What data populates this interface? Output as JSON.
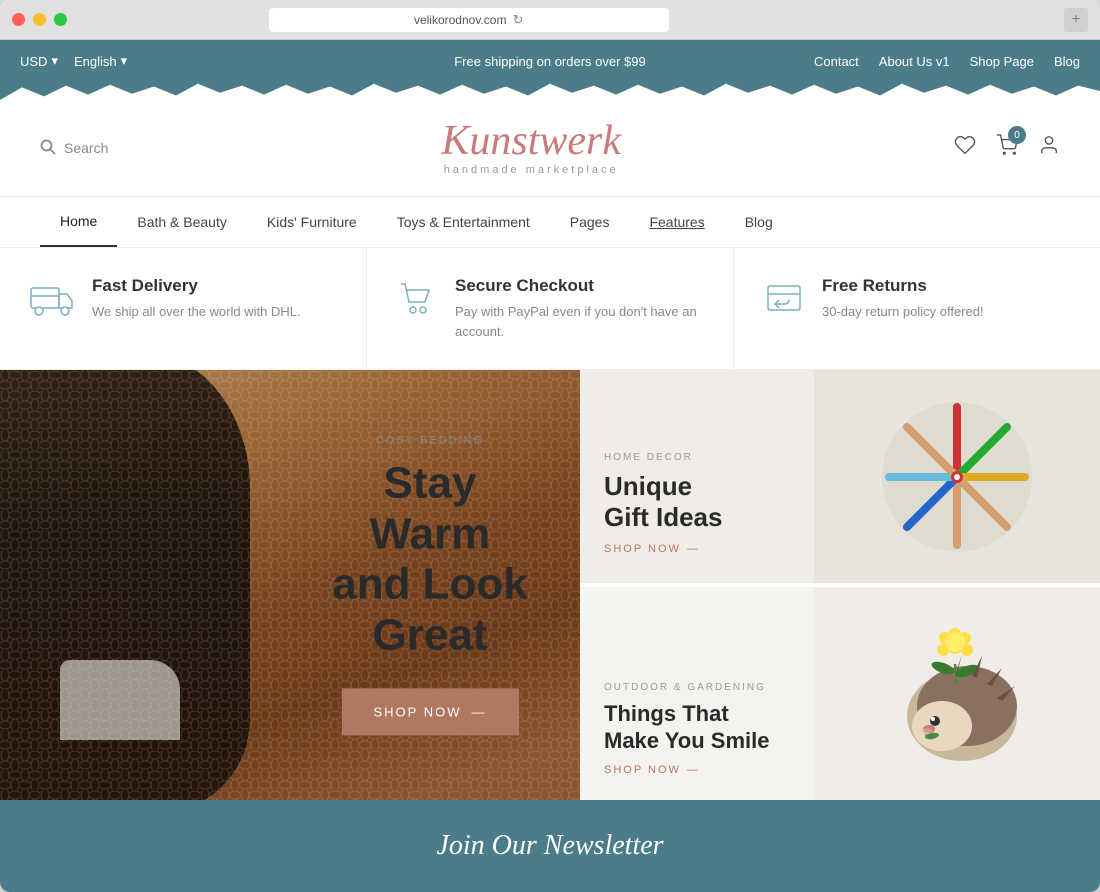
{
  "browser": {
    "url": "velikorodnov.com",
    "new_tab_label": "+"
  },
  "topbar": {
    "currency": "USD",
    "language": "English",
    "shipping_notice": "Free shipping on orders over $99",
    "nav_contact": "Contact",
    "nav_about": "About Us v1",
    "nav_shop": "Shop Page",
    "nav_blog": "Blog"
  },
  "header": {
    "search_placeholder": "Search",
    "logo": "Kunstwerk",
    "tagline": "handmade marketplace",
    "cart_count": "0"
  },
  "nav": {
    "items": [
      {
        "label": "Home",
        "active": true
      },
      {
        "label": "Bath & Beauty",
        "active": false
      },
      {
        "label": "Kids' Furniture",
        "active": false
      },
      {
        "label": "Toys & Entertainment",
        "active": false
      },
      {
        "label": "Pages",
        "active": false
      },
      {
        "label": "Features",
        "active": false,
        "underline": true
      },
      {
        "label": "Blog",
        "active": false
      }
    ]
  },
  "features": [
    {
      "icon": "truck",
      "title": "Fast Delivery",
      "desc": "We ship all over the world with DHL."
    },
    {
      "icon": "cart",
      "title": "Secure Checkout",
      "desc": "Pay with PayPal even if you don't have an account."
    },
    {
      "icon": "return",
      "title": "Free Returns",
      "desc": "30-day return policy offered!"
    }
  ],
  "hero": {
    "category": "COSY BEDDING",
    "title_line1": "Stay Warm",
    "title_line2": "and Look",
    "title_line3": "Great",
    "cta": "SHOP NOW",
    "cta_arrow": "—"
  },
  "panel_top": {
    "category": "HOME DECOR",
    "title_line1": "Unique",
    "title_line2": "Gift Ideas",
    "shop_link": "SHOP NOW",
    "shop_arrow": "—"
  },
  "panel_bottom": {
    "category": "OUTDOOR & GARDENING",
    "title_line1": "Things That",
    "title_line2": "Make You Smile",
    "shop_link": "SHOP NOW",
    "shop_arrow": "—"
  },
  "newsletter": {
    "title": "Join Our Newsletter"
  },
  "colors": {
    "teal": "#4a7c8a",
    "salmon": "#b07860",
    "knit_brown": "#a07040"
  }
}
